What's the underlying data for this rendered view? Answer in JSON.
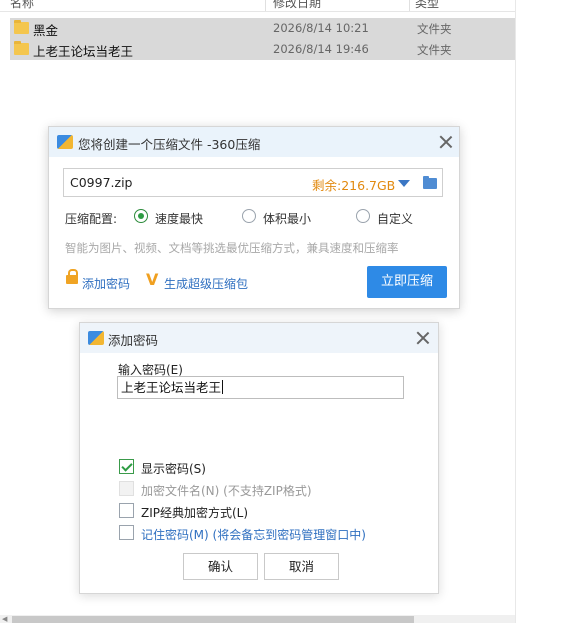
{
  "explorer": {
    "columns": [
      "名称",
      "修改日期",
      "类型"
    ],
    "rows": [
      {
        "name": "黑金",
        "date": "2026/8/14 10:21",
        "type": "文件夹"
      },
      {
        "name": "上老王论坛当老王",
        "date": "2026/8/14 19:46",
        "type": "文件夹"
      }
    ]
  },
  "compress_dialog": {
    "title": "您将创建一个压缩文件 -360压缩",
    "filename": "C0997.zip",
    "remaining": "剩余:216.7GB",
    "config_label": "压缩配置:",
    "options": [
      "速度最快",
      "体积最小",
      "自定义"
    ],
    "selected_option": "速度最快",
    "hint": "智能为图片、视频、文档等挑选最优压缩方式，兼具速度和压缩率",
    "add_password_link": "添加密码",
    "super_package_link": "生成超级压缩包",
    "compress_button": "立即压缩"
  },
  "password_dialog": {
    "title": "添加密码",
    "input_label": "输入密码(E)",
    "password_value": "上老王论坛当老王",
    "checkboxes": [
      {
        "label": "显示密码(S)",
        "checked": true,
        "enabled": true
      },
      {
        "label": "加密文件名(N) (不支持ZIP格式)",
        "checked": false,
        "enabled": false
      },
      {
        "label": "ZIP经典加密方式(L)",
        "checked": false,
        "enabled": true
      },
      {
        "label": "记住密码(M) (将会备忘到密码管理窗口中)",
        "checked": false,
        "enabled": true
      }
    ],
    "ok_button": "确认",
    "cancel_button": "取消"
  },
  "colors": {
    "accent": "#2e8ae6",
    "link": "#2f6fc0",
    "remaining": "#e28a10",
    "check": "#2d9c43"
  }
}
